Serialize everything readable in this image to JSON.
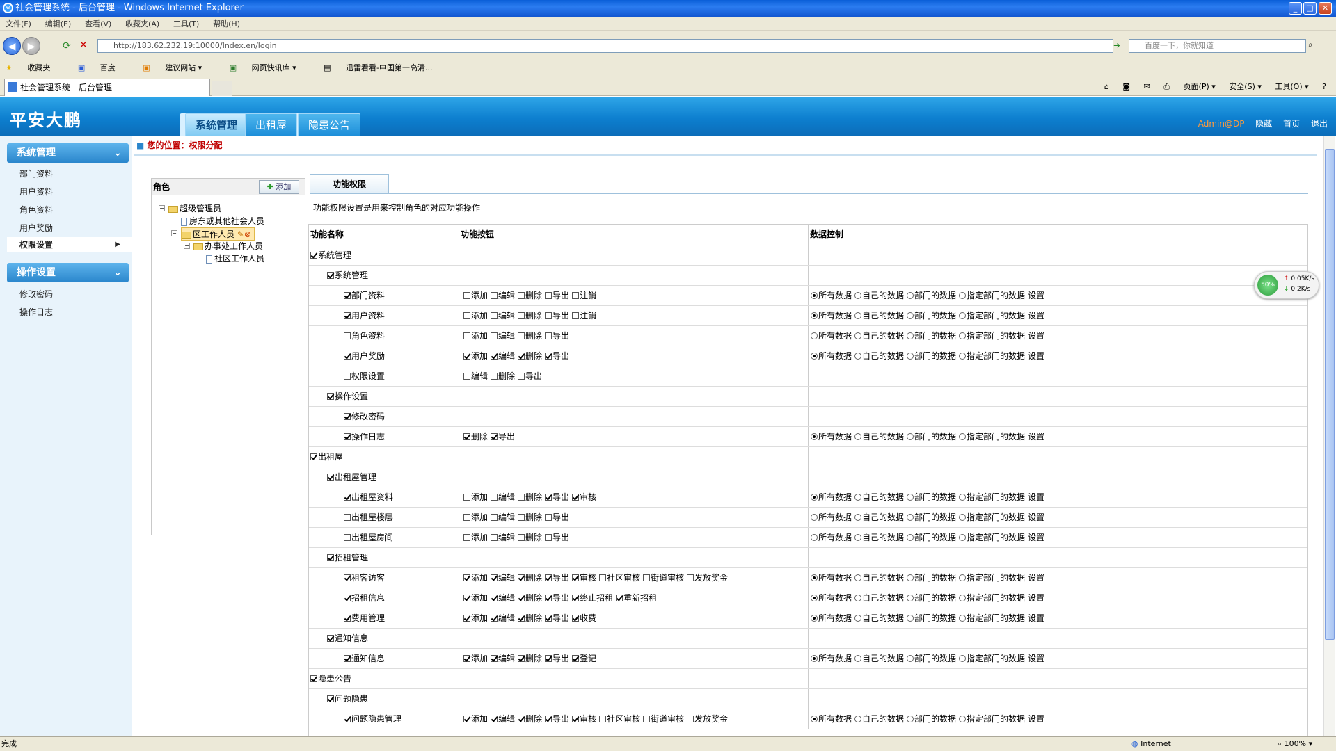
{
  "window": {
    "title": "社会管理系统 - 后台管理 - Windows Internet Explorer",
    "min": "_",
    "max": "□",
    "close": "✕"
  },
  "menubar": [
    "文件(F)",
    "编辑(E)",
    "查看(V)",
    "收藏夹(A)",
    "工具(T)",
    "帮助(H)"
  ],
  "address": {
    "url": "http://183.62.232.19:10000/Index.en/login",
    "search_placeholder": "百度一下，你就知道"
  },
  "favorites": [
    "收藏夹",
    "百度",
    "建议网站 ▾",
    "网页快讯库 ▾",
    "迅雷看看-中国第一高清..."
  ],
  "browser_tab": {
    "label": "社会管理系统 - 后台管理"
  },
  "browser_tools": [
    "页面(P) ▾",
    "安全(S) ▾",
    "工具(O) ▾"
  ],
  "app": {
    "logo": "平安大鹏",
    "nav": [
      "系统管理",
      "出租屋",
      "隐患公告"
    ],
    "user": "Admin@DP",
    "links": [
      "隐藏",
      "首页",
      "退出"
    ]
  },
  "sidebar": {
    "sections": [
      {
        "title": "系统管理",
        "items": [
          "部门资料",
          "用户资料",
          "角色资料",
          "用户奖励",
          "权限设置"
        ]
      },
      {
        "title": "操作设置",
        "items": [
          "修改密码",
          "操作日志"
        ]
      }
    ]
  },
  "breadcrumb": "您的位置：权限分配",
  "roles": {
    "header": "角色",
    "add": "添加",
    "tree": [
      "超级管理员",
      "房东或其他社会人员",
      "区工作人员",
      "办事处工作人员",
      "社区工作人员"
    ]
  },
  "func": {
    "tab": "功能权限",
    "desc": "功能权限设置是用来控制角色的对应功能操作",
    "headers": [
      "功能名称",
      "功能按钮",
      "数据控制"
    ],
    "data_options": [
      "所有数据",
      "自己的数据",
      "部门的数据",
      "指定部门的数据"
    ],
    "set_label": "设置",
    "rows": [
      {
        "level": 0,
        "name": "系统管理",
        "checked": true
      },
      {
        "level": 1,
        "name": "系统管理",
        "checked": true
      },
      {
        "level": 2,
        "name": "部门资料",
        "checked": true,
        "buttons": [
          [
            "添加",
            false
          ],
          [
            "编辑",
            false
          ],
          [
            "删除",
            false
          ],
          [
            "导出",
            false
          ],
          [
            "注销",
            false
          ]
        ],
        "data": true,
        "sel": 0
      },
      {
        "level": 2,
        "name": "用户资料",
        "checked": true,
        "buttons": [
          [
            "添加",
            false
          ],
          [
            "编辑",
            false
          ],
          [
            "删除",
            false
          ],
          [
            "导出",
            false
          ],
          [
            "注销",
            false
          ]
        ],
        "data": true,
        "sel": 0
      },
      {
        "level": 2,
        "name": "角色资料",
        "checked": false,
        "buttons": [
          [
            "添加",
            false
          ],
          [
            "编辑",
            false
          ],
          [
            "删除",
            false
          ],
          [
            "导出",
            false
          ]
        ],
        "data": true,
        "sel": -1
      },
      {
        "level": 2,
        "name": "用户奖励",
        "checked": true,
        "buttons": [
          [
            "添加",
            true
          ],
          [
            "编辑",
            true
          ],
          [
            "删除",
            true
          ],
          [
            "导出",
            true
          ]
        ],
        "data": true,
        "sel": 0
      },
      {
        "level": 2,
        "name": "权限设置",
        "checked": false,
        "buttons": [
          [
            "编辑",
            false
          ],
          [
            "删除",
            false
          ],
          [
            "导出",
            false
          ]
        ],
        "data": false
      },
      {
        "level": 1,
        "name": "操作设置",
        "checked": true
      },
      {
        "level": 2,
        "name": "修改密码",
        "checked": true
      },
      {
        "level": 2,
        "name": "操作日志",
        "checked": true,
        "buttons": [
          [
            "删除",
            true
          ],
          [
            "导出",
            true
          ]
        ],
        "data": true,
        "sel": 0
      },
      {
        "level": 0,
        "name": "出租屋",
        "checked": true
      },
      {
        "level": 1,
        "name": "出租屋管理",
        "checked": true
      },
      {
        "level": 2,
        "name": "出租屋资料",
        "checked": true,
        "buttons": [
          [
            "添加",
            false
          ],
          [
            "编辑",
            false
          ],
          [
            "删除",
            false
          ],
          [
            "导出",
            true
          ],
          [
            "审核",
            true
          ]
        ],
        "data": true,
        "sel": 0
      },
      {
        "level": 2,
        "name": "出租屋楼层",
        "checked": false,
        "buttons": [
          [
            "添加",
            false
          ],
          [
            "编辑",
            false
          ],
          [
            "删除",
            false
          ],
          [
            "导出",
            false
          ]
        ],
        "data": true,
        "sel": -1
      },
      {
        "level": 2,
        "name": "出租屋房间",
        "checked": false,
        "buttons": [
          [
            "添加",
            false
          ],
          [
            "编辑",
            false
          ],
          [
            "删除",
            false
          ],
          [
            "导出",
            false
          ]
        ],
        "data": true,
        "sel": -1
      },
      {
        "level": 1,
        "name": "招租管理",
        "checked": true
      },
      {
        "level": 2,
        "name": "租客访客",
        "checked": true,
        "buttons": [
          [
            "添加",
            true
          ],
          [
            "编辑",
            true
          ],
          [
            "删除",
            true
          ],
          [
            "导出",
            true
          ],
          [
            "审核",
            true
          ],
          [
            "社区审核",
            false
          ],
          [
            "街道审核",
            false
          ],
          [
            "发放奖金",
            false
          ]
        ],
        "data": true,
        "sel": 0
      },
      {
        "level": 2,
        "name": "招租信息",
        "checked": true,
        "buttons": [
          [
            "添加",
            true
          ],
          [
            "编辑",
            true
          ],
          [
            "删除",
            true
          ],
          [
            "导出",
            true
          ],
          [
            "终止招租",
            true
          ],
          [
            "重新招租",
            true
          ]
        ],
        "data": true,
        "sel": 0
      },
      {
        "level": 2,
        "name": "费用管理",
        "checked": true,
        "buttons": [
          [
            "添加",
            true
          ],
          [
            "编辑",
            true
          ],
          [
            "删除",
            true
          ],
          [
            "导出",
            true
          ],
          [
            "收费",
            true
          ]
        ],
        "data": true,
        "sel": 0
      },
      {
        "level": 1,
        "name": "通知信息",
        "checked": true
      },
      {
        "level": 2,
        "name": "通知信息",
        "checked": true,
        "buttons": [
          [
            "添加",
            true
          ],
          [
            "编辑",
            true
          ],
          [
            "删除",
            true
          ],
          [
            "导出",
            true
          ],
          [
            "登记",
            true
          ]
        ],
        "data": true,
        "sel": 0
      },
      {
        "level": 0,
        "name": "隐患公告",
        "checked": true
      },
      {
        "level": 1,
        "name": "问题隐患",
        "checked": true
      },
      {
        "level": 2,
        "name": "问题隐患管理",
        "checked": true,
        "buttons": [
          [
            "添加",
            true
          ],
          [
            "编辑",
            true
          ],
          [
            "删除",
            true
          ],
          [
            "导出",
            true
          ],
          [
            "审核",
            true
          ],
          [
            "社区审核",
            false
          ],
          [
            "街道审核",
            false
          ],
          [
            "发放奖金",
            false
          ]
        ],
        "data": true,
        "sel": 0
      }
    ]
  },
  "network": {
    "percent": "50%",
    "up": "0.05K/s",
    "down": "0.2K/s"
  },
  "status": {
    "text": "完成",
    "zone": "Internet",
    "zoom": "100%"
  }
}
